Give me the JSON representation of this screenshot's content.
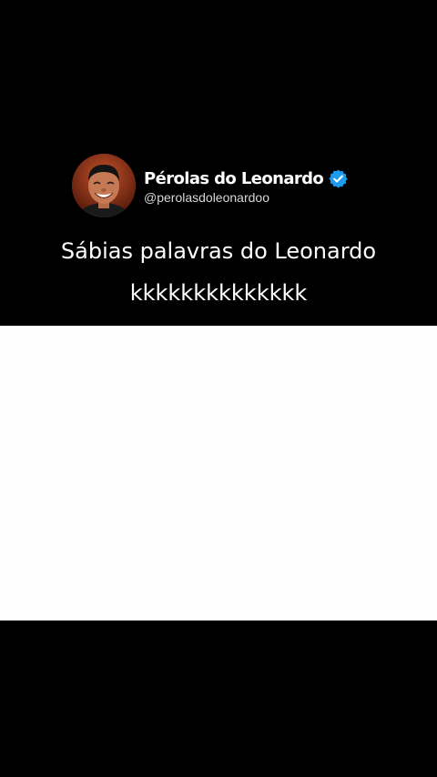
{
  "post": {
    "author": {
      "display_name": "Pérolas do Leonardo",
      "handle": "@perolasdoleonardoo",
      "verified_icon": "verified-badge-icon",
      "verified_color": "#1d9bf0"
    },
    "text_lines": [
      "Sábias palavras do Leonardo",
      "kkkkkkkkkkkkkk"
    ]
  },
  "colors": {
    "background": "#000000",
    "media_area": "#fefefe",
    "text": "#ffffff"
  }
}
